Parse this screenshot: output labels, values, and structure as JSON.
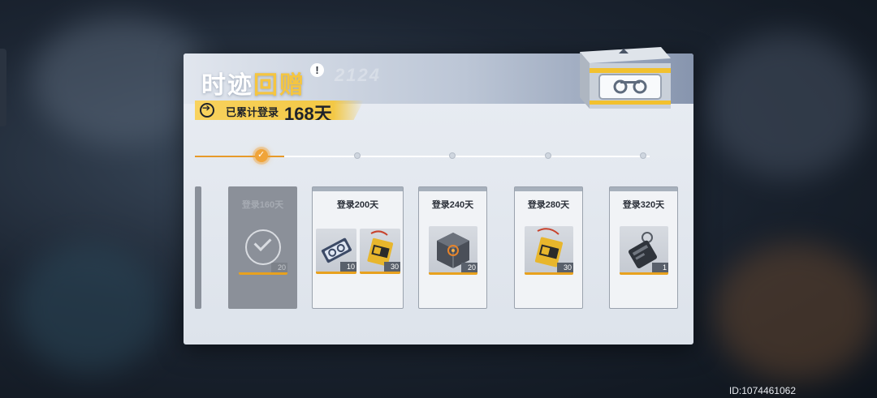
{
  "panel": {
    "title_part1": "时迹",
    "title_part2": "回赠",
    "info_icon": "!",
    "watermark": "2124",
    "login_label": "已累计登录",
    "login_count": "168天"
  },
  "progress": {
    "nodes": 6,
    "current_index": 1
  },
  "rewards": [
    {
      "title": "登录160天",
      "claimed": true,
      "items": [
        {
          "icon": "check-icon",
          "count": "20"
        }
      ]
    },
    {
      "title": "登录200天",
      "claimed": false,
      "items": [
        {
          "icon": "tape-module-icon",
          "count": "10"
        },
        {
          "icon": "gold-tag-icon",
          "count": "30"
        }
      ]
    },
    {
      "title": "登录240天",
      "claimed": false,
      "items": [
        {
          "icon": "glass-cube-icon",
          "count": "20"
        }
      ]
    },
    {
      "title": "登录280天",
      "claimed": false,
      "items": [
        {
          "icon": "gold-tag-icon",
          "count": "30"
        }
      ]
    },
    {
      "title": "登录320天",
      "claimed": false,
      "items": [
        {
          "icon": "dark-keychain-icon",
          "count": "1"
        }
      ]
    }
  ],
  "footer": {
    "id_text": "ID:1074461062"
  },
  "colors": {
    "accent": "#f3c845",
    "progress": "#e79a2a",
    "highlight_text": "#f5c540"
  }
}
